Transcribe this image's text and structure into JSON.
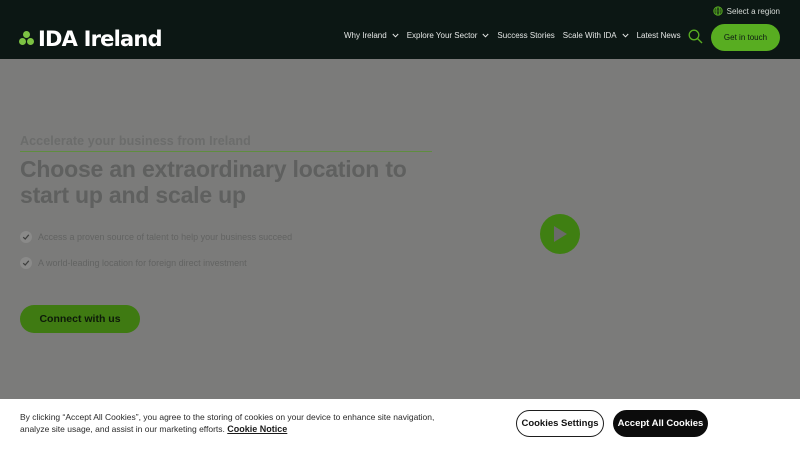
{
  "header": {
    "logo_text": "IDA Ireland",
    "region_label": "Select a region",
    "nav": [
      {
        "label": "Why Ireland",
        "has_dropdown": true
      },
      {
        "label": "Explore Your Sector",
        "has_dropdown": true
      },
      {
        "label": "Success Stories",
        "has_dropdown": false
      },
      {
        "label": "Scale With IDA",
        "has_dropdown": true
      },
      {
        "label": "Latest News",
        "has_dropdown": false
      }
    ],
    "search_icon": "search-icon",
    "cta_label": "Get in touch"
  },
  "hero": {
    "kicker": "Accelerate your business from Ireland",
    "title": "Choose an extraordinary location to start up and scale up",
    "bullets": [
      "Access a proven source of talent to help your business succeed",
      "A world-leading location for foreign direct investment"
    ],
    "connect_label": "Connect with us",
    "play_icon": "play-icon"
  },
  "cookie": {
    "text": "By clicking “Accept All Cookies”, you agree to the storing of cookies on your device to enhance site navigation, analyze site usage, and assist in our marketing efforts.",
    "notice_link": "Cookie Notice",
    "settings_label": "Cookies Settings",
    "accept_label": "Accept All Cookies"
  },
  "colors": {
    "header_bg": "#0c1714",
    "accent_green": "#58ad21",
    "hero_overlay": "#7b7b7a",
    "cookie_bg": "#ffffff"
  }
}
